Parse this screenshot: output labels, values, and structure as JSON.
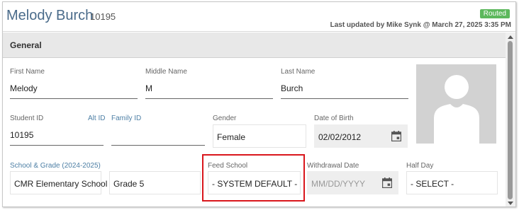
{
  "header": {
    "student_name": "Melody Burch",
    "student_id": "10195",
    "status": "Routed",
    "last_updated": "Last updated by Mike Synk @ March 27, 2025 3:35 PM"
  },
  "section": {
    "title": "General"
  },
  "fields": {
    "first_name": {
      "label": "First Name",
      "value": "Melody"
    },
    "middle_name": {
      "label": "Middle Name",
      "value": "M"
    },
    "last_name": {
      "label": "Last Name",
      "value": "Burch"
    },
    "student_id": {
      "label": "Student ID",
      "alt_link": "Alt ID",
      "value": "10195"
    },
    "family_id": {
      "label": "Family ID",
      "value": ""
    },
    "gender": {
      "label": "Gender",
      "value": "Female"
    },
    "dob": {
      "label": "Date of Birth",
      "value": "02/02/2012"
    },
    "school_grade": {
      "label": "School & Grade (2024-2025)",
      "school": "CMR Elementary School",
      "grade": "Grade 5"
    },
    "feed_school": {
      "label": "Feed School",
      "value": "- SYSTEM DEFAULT -"
    },
    "withdrawal_date": {
      "label": "Withdrawal Date",
      "placeholder": "MM/DD/YYYY"
    },
    "half_day": {
      "label": "Half Day",
      "value": "- SELECT -"
    }
  },
  "colors": {
    "status_badge": "#5cb85c",
    "highlight": "#d9161c",
    "name": "#4a6b8a"
  },
  "icons": {
    "calendar": "calendar-icon",
    "photo": "person-silhouette-icon"
  }
}
